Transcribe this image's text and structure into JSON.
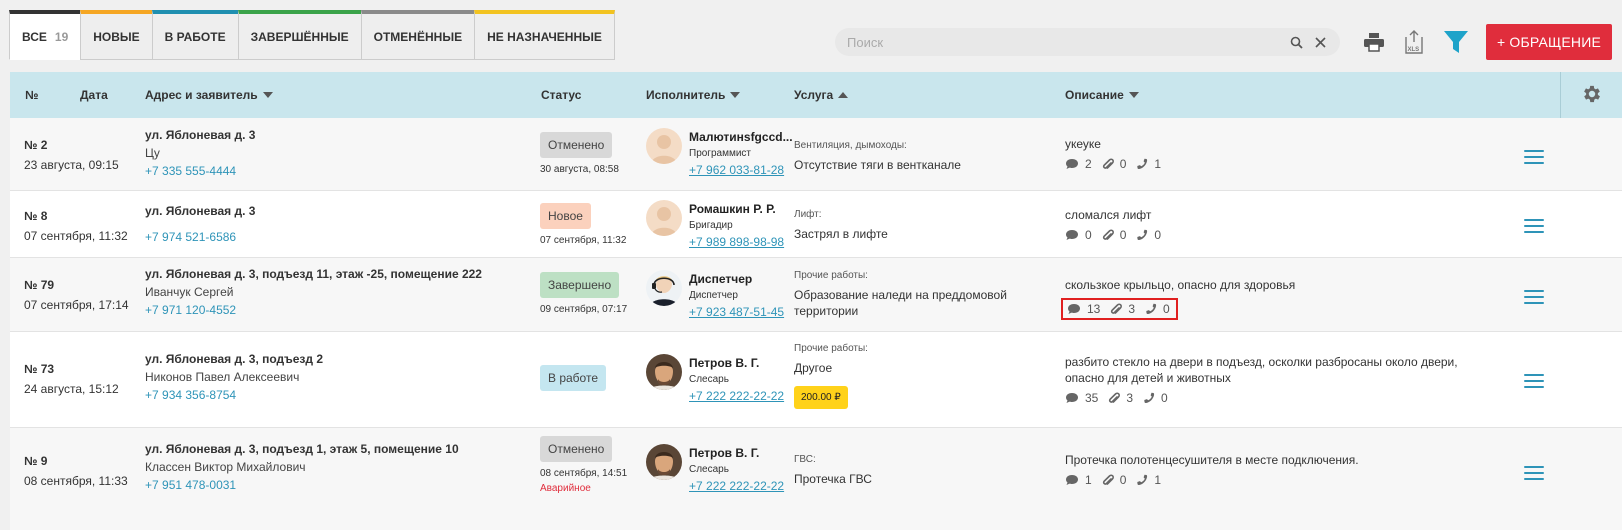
{
  "tabs": [
    {
      "label": "ВСЕ",
      "count": "19",
      "color": "#333333",
      "active": true
    },
    {
      "label": "НОВЫЕ",
      "color": "#f5a623"
    },
    {
      "label": "В РАБОТЕ",
      "color": "#1f8fb0"
    },
    {
      "label": "ЗАВЕРШЁННЫЕ",
      "color": "#3aa349"
    },
    {
      "label": "ОТМЕНЁННЫЕ",
      "color": "#8a8a8a"
    },
    {
      "label": "НЕ НАЗНАЧЕННЫЕ",
      "color": "#f2c320"
    }
  ],
  "search": {
    "placeholder": "Поиск"
  },
  "new_button": "+ ОБРАЩЕНИЕ",
  "columns": {
    "num": "№",
    "date": "Дата",
    "address": "Адрес и заявитель",
    "status": "Статус",
    "executor": "Исполнитель",
    "service": "Услуга",
    "description": "Описание"
  },
  "rows": [
    {
      "num": "№ 2",
      "date": "23 августа, 09:15",
      "address": "ул. Яблоневая д. 3",
      "applicant": "Цу",
      "phone": "+7 335 555-4444",
      "status": "Отменено",
      "status_kind": "cancel",
      "status_date": "30 августа, 08:58",
      "emergency": "",
      "exec_name": "Малютинsfgccd...",
      "exec_role": "Программист",
      "exec_phone": "+7 962 033-81-28",
      "avatar": "placeholder",
      "svc_cat": "Вентиляция, дымоходы:",
      "svc_name": "Отсутствие тяги в вентканале",
      "price": "",
      "desc": "укеуке",
      "comments": "2",
      "files": "0",
      "calls": "1"
    },
    {
      "num": "№ 8",
      "date": "07 сентября, 11:32",
      "address": "ул. Яблоневая д. 3",
      "applicant": "",
      "phone": "+7 974 521-6586",
      "status": "Новое",
      "status_kind": "new",
      "status_date": "07 сентября, 11:32",
      "emergency": "",
      "exec_name": "Ромашкин Р. Р.",
      "exec_role": "Бригадир",
      "exec_phone": "+7 989 898-98-98",
      "avatar": "placeholder",
      "svc_cat": "Лифт:",
      "svc_name": "Застрял в лифте",
      "price": "",
      "desc": "сломался лифт",
      "comments": "0",
      "files": "0",
      "calls": "0"
    },
    {
      "num": "№ 79",
      "date": "07 сентября, 17:14",
      "address": "ул. Яблоневая д. 3, подъезд 11, этаж -25, помещение 222",
      "applicant": "Иванчук Сергей",
      "phone": "+7 971 120-4552",
      "status": "Завершено",
      "status_kind": "done",
      "status_date": "09 сентября, 07:17",
      "emergency": "",
      "exec_name": "Диспетчер",
      "exec_role": "Диспетчер",
      "exec_phone": "+7 923 487-51-45",
      "avatar": "dispatcher",
      "svc_cat": "Прочие работы:",
      "svc_name": "Образование наледи на преддомовой территории",
      "price": "",
      "desc": "скользкое крыльцо, опасно для здоровья",
      "comments": "13",
      "files": "3",
      "calls": "0",
      "highlight": true
    },
    {
      "num": "№ 73",
      "date": "24 августа, 15:12",
      "address": "ул. Яблоневая д. 3, подъезд 2",
      "applicant": "Никонов Павел Алексеевич",
      "phone": "+7 934 356-8754",
      "status": "В работе",
      "status_kind": "work",
      "status_date": "",
      "emergency": "",
      "exec_name": "Петров В. Г.",
      "exec_role": "Слесарь",
      "exec_phone": "+7 222 222-22-22",
      "avatar": "man",
      "svc_cat": "Прочие работы:",
      "svc_name": "Другое",
      "price": "200.00 ₽",
      "desc": "разбито стекло на двери в подъезд, осколки разбросаны около двери, опасно для детей и животных",
      "comments": "35",
      "files": "3",
      "calls": "0"
    },
    {
      "num": "№ 9",
      "date": "08 сентября, 11:33",
      "address": "ул. Яблоневая д. 3, подъезд 1, этаж 5, помещение 10",
      "applicant": "Классен Виктор Михайлович",
      "phone": "+7 951 478-0031",
      "status": "Отменено",
      "status_kind": "cancel",
      "status_date": "08 сентября, 14:51",
      "emergency": "Аварийное",
      "exec_name": "Петров В. Г.",
      "exec_role": "Слесарь",
      "exec_phone": "+7 222 222-22-22",
      "avatar": "man",
      "svc_cat": "ГВС:",
      "svc_name": "Протечка ГВС",
      "price": "",
      "desc": "Протечка полотенцесушителя в месте подключения.",
      "comments": "1",
      "files": "0",
      "calls": "1"
    }
  ],
  "colors": {
    "accent": "#2e94b8",
    "brand_red": "#e02d3c",
    "header_bg": "#c9e6ed"
  }
}
